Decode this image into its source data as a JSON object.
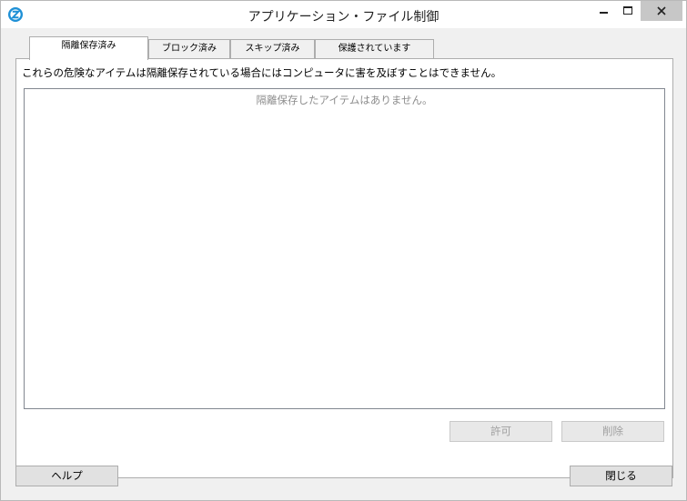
{
  "window": {
    "title": "アプリケーション・ファイル制御",
    "icon": "zonealarm-z-icon",
    "controls": {
      "minimize": "minimize-icon",
      "maximize": "maximize-icon",
      "close": "close-icon"
    }
  },
  "tabs": [
    {
      "label": "隔離保存済み",
      "active": true
    },
    {
      "label": "ブロック済み",
      "active": false
    },
    {
      "label": "スキップ済み",
      "active": false
    },
    {
      "label": "保護されています",
      "active": false
    }
  ],
  "panel": {
    "description": "これらの危険なアイテムは隔離保存されている場合にはコンピュータに害を及ぼすことはできません。",
    "empty_message": "隔離保存したアイテムはありません。",
    "allow_label": "許可",
    "delete_label": "削除"
  },
  "footer": {
    "help_label": "ヘルプ",
    "close_label": "閉じる"
  },
  "colors": {
    "accent": "#1e90d6",
    "close_button_bg": "#c7c7c7"
  }
}
